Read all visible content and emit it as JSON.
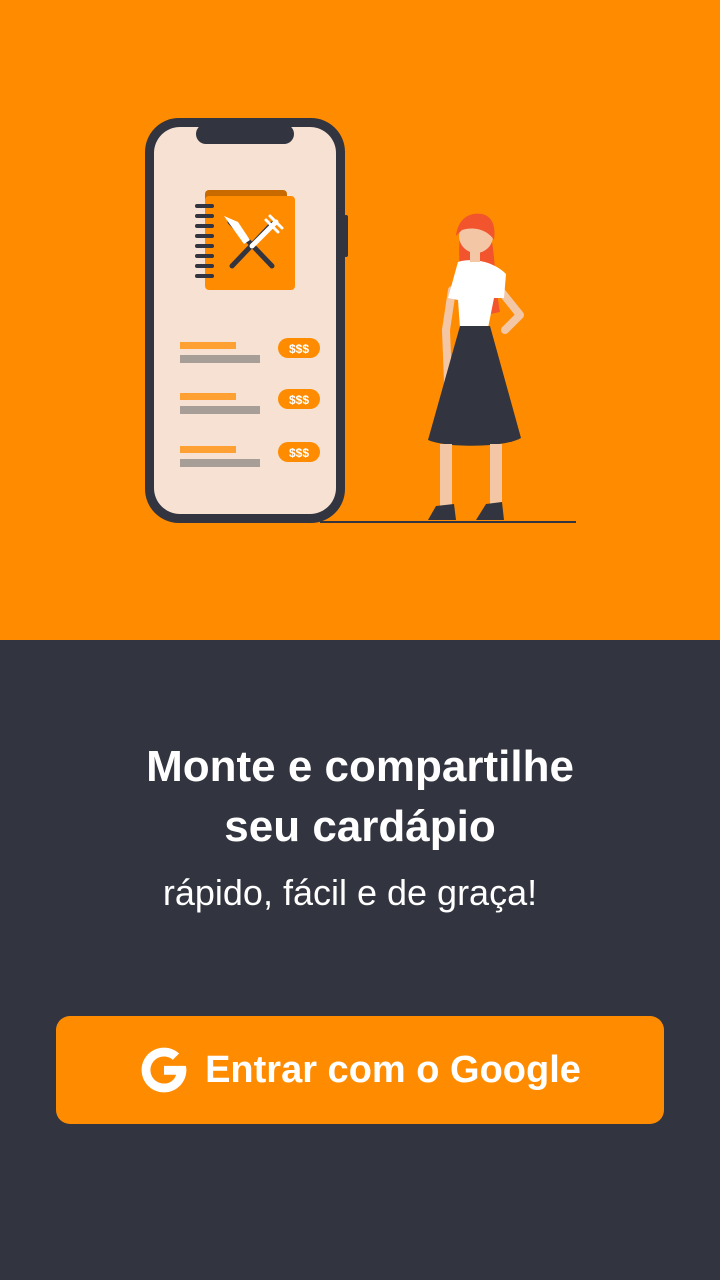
{
  "colors": {
    "accent": "#ff8c00",
    "dark_bg": "#32343f",
    "text_primary": "#ffffff",
    "phone_screen": "#f7e1d3",
    "phone_frame": "#32343f",
    "price_text": "#ffffff"
  },
  "hero": {
    "menu_items": [
      {
        "price": "$$$"
      },
      {
        "price": "$$$"
      },
      {
        "price": "$$$"
      }
    ]
  },
  "content": {
    "title_line1": "Monte e compartilhe",
    "title_line2": "seu cardápio",
    "subtitle": "rápido, fácil e de graça!"
  },
  "login": {
    "google_button_label": "Entrar com o Google",
    "google_icon": "google-g-icon"
  }
}
